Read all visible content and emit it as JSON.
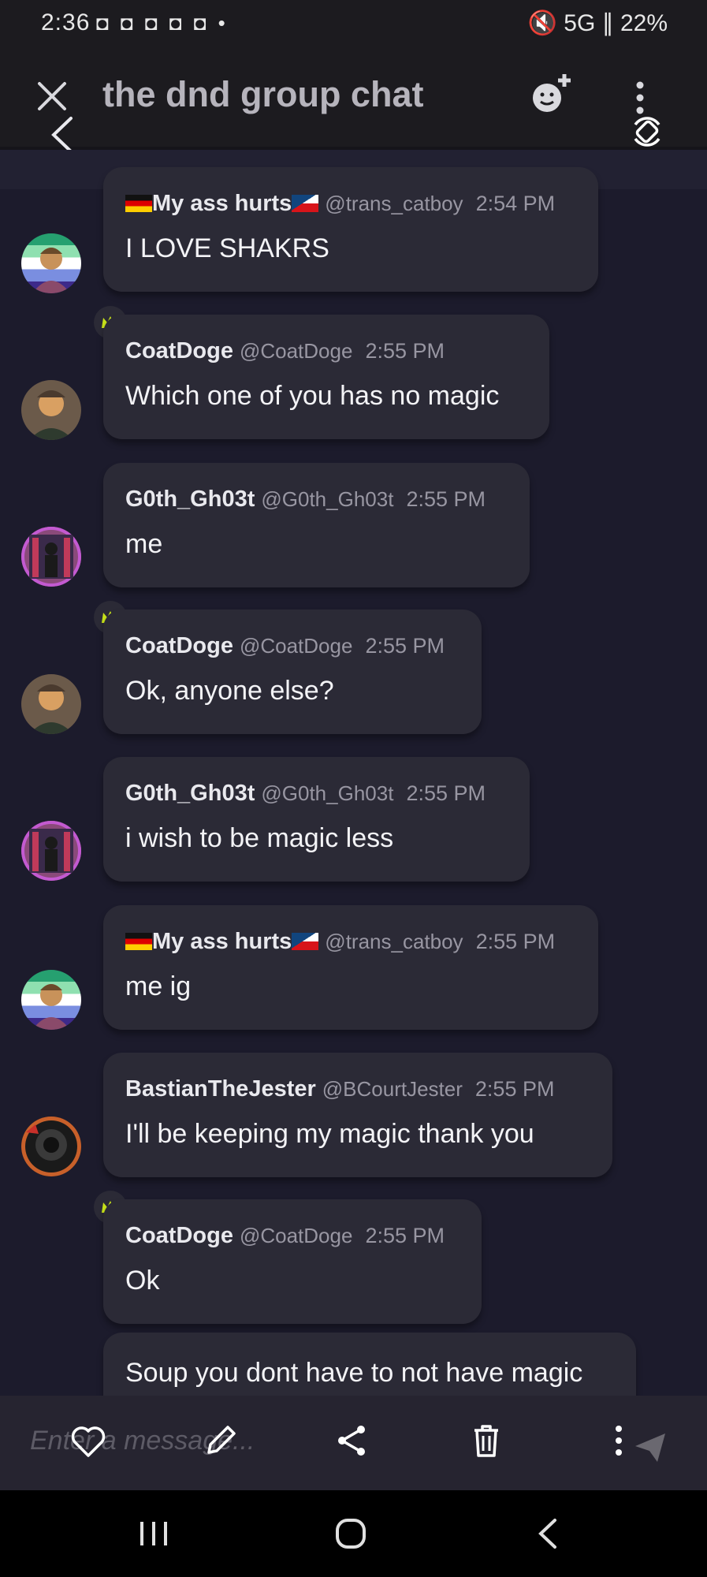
{
  "status_bar": {
    "time": "2:36",
    "notification_icons": "◘ ◘ ◘ ◘ ◘ •",
    "right": "🔇 5G ∥ 22%"
  },
  "header": {
    "title": "the dnd group chat"
  },
  "messages": [
    {
      "name": "🇩🇪My ass hurts🇨🇿",
      "name_text": "My ass hurts",
      "handle": "@trans_catboy",
      "time": "2:54 PM",
      "text": "I LOVE SHAKRS",
      "crown": false
    },
    {
      "name_text": "CoatDoge",
      "handle": "@CoatDoge",
      "time": "2:55 PM",
      "text": "Which one of you has no magic",
      "crown": true
    },
    {
      "name_text": "G0th_Gh03t",
      "handle": "@G0th_Gh03t",
      "time": "2:55 PM",
      "text": "me",
      "crown": false
    },
    {
      "name_text": "CoatDoge",
      "handle": "@CoatDoge",
      "time": "2:55 PM",
      "text": "Ok, anyone else?",
      "crown": true
    },
    {
      "name_text": "G0th_Gh03t",
      "handle": "@G0th_Gh03t",
      "time": "2:55 PM",
      "text": "i wish to be magic less",
      "crown": false
    },
    {
      "name_text": "My ass hurts",
      "handle": "@trans_catboy",
      "time": "2:55 PM",
      "text": "me ig",
      "crown": false
    },
    {
      "name_text": "BastianTheJester",
      "handle": "@BCourtJester",
      "time": "2:55 PM",
      "text": "I'll be keeping my magic thank you",
      "crown": false
    },
    {
      "name_text": "CoatDoge",
      "handle": "@CoatDoge",
      "time": "2:55 PM",
      "text": "Ok",
      "crown": true
    },
    {
      "text": "Soup you dont have to not have magic"
    }
  ],
  "input": {
    "placeholder": "Enter a message..."
  },
  "colors": {
    "background": "#1c1b2c",
    "bubble": "#2b2a36",
    "crown": "#c8e31a"
  }
}
